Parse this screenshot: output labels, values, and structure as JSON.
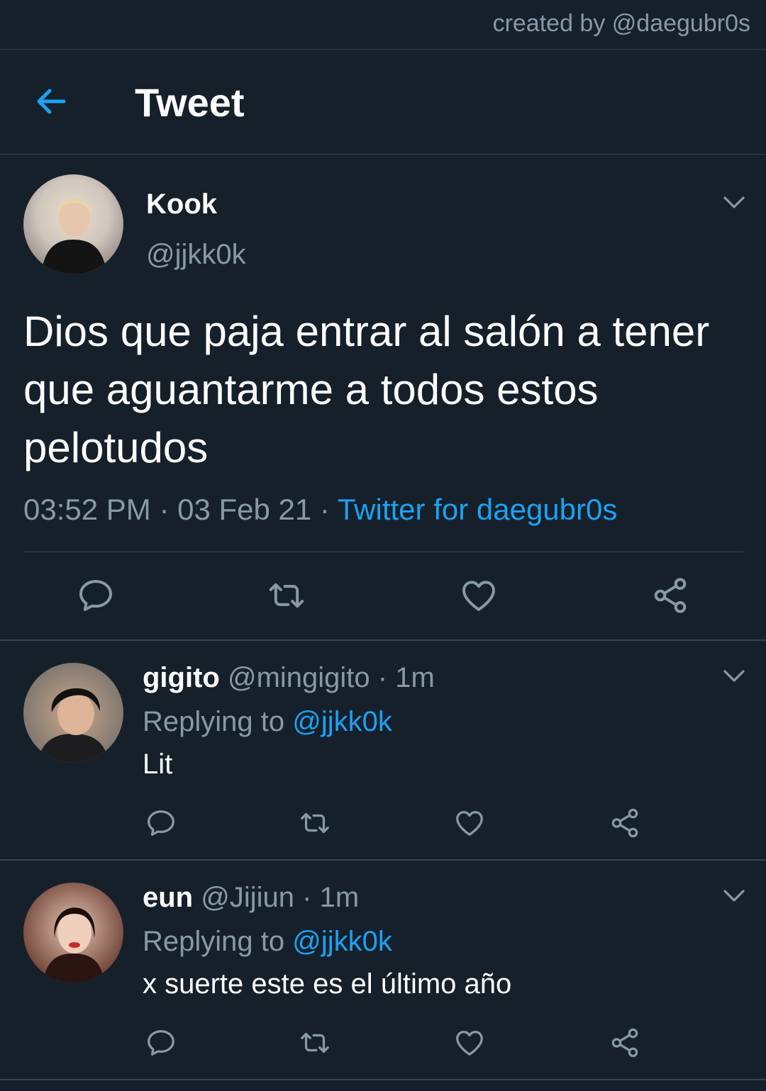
{
  "watermark": "created by @daegubr0s",
  "header": {
    "title": "Tweet"
  },
  "tweet": {
    "name": "Kook",
    "handle": "@jjkk0k",
    "text": "Dios que paja entrar al salón a tener que aguantarme a todos estos pelotudos",
    "time": "03:52 PM",
    "date": "03 Feb 21",
    "separator": " · ",
    "source": "Twitter for daegubr0s"
  },
  "replies": [
    {
      "name": "gigito",
      "handle": "@mingigito",
      "time": "1m",
      "replying_label": "Replying to",
      "replying_to": "@jjkk0k",
      "text": "Lit"
    },
    {
      "name": "eun",
      "handle": "@Jijiun",
      "time": "1m",
      "replying_label": "Replying to",
      "replying_to": "@jjkk0k",
      "text": "x suerte este es el último año"
    }
  ],
  "colors": {
    "background": "#15202b",
    "accent": "#1da1f2",
    "muted": "#8899a6",
    "divider": "#38444d"
  },
  "icons": [
    "back-arrow-icon",
    "chevron-down-icon",
    "reply-icon",
    "retweet-icon",
    "like-icon",
    "share-icon"
  ]
}
